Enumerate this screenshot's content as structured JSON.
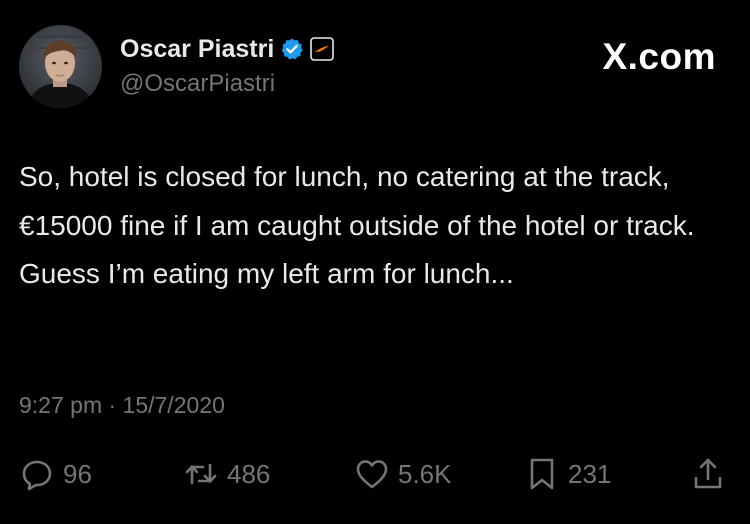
{
  "tweet": {
    "author": {
      "display_name": "Oscar Piastri",
      "handle": "@OscarPiastri",
      "verified_icon": "verified-badge-icon",
      "affiliate_icon": "mclaren-affiliate-icon"
    },
    "brand": "X.com",
    "text": "So, hotel is closed for lunch, no catering at the track, €15000 fine if I am caught outside of the hotel or track. Guess I’m eating my left arm for lunch...",
    "meta": "9:27 pm · 15/7/2020",
    "actions": {
      "replies": "96",
      "reposts": "486",
      "likes": "5.6K",
      "bookmarks": "231"
    }
  },
  "colors": {
    "background": "#000000",
    "text_primary": "#e7e9ea",
    "text_secondary": "#71767b",
    "verified_blue": "#1d9bf0",
    "affiliate_orange": "#ff8000"
  }
}
